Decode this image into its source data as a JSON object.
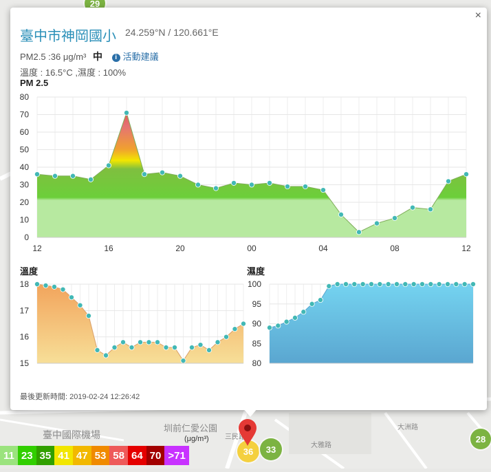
{
  "popup": {
    "title": "臺中市神岡國小",
    "coords": "24.259°N / 120.661°E",
    "pm_text": "PM2.5 :36 μg/m³",
    "pm_level": "中",
    "advice_link": "活動建議",
    "env_text": "溫度 : 16.5°C ,濕度 : 100%",
    "pm_chart_title": "PM 2.5",
    "temp_chart_title": "溫度",
    "humidity_chart_title": "濕度",
    "updated": "最後更新時間: 2019-02-24 12:26:42",
    "close": "×"
  },
  "map": {
    "labels": [
      "臺中國際機場",
      "圳前仁愛公園",
      "三民路",
      "大雅路",
      "大洲路"
    ],
    "unit": "(μg/m³)",
    "markers": [
      {
        "value": "29",
        "color": "#7cb342"
      },
      {
        "value": "36",
        "color": "#f4d03f"
      },
      {
        "value": "33",
        "color": "#7cb342"
      },
      {
        "value": "28",
        "color": "#7cb342"
      }
    ]
  },
  "legend": [
    {
      "label": "11",
      "color": "#9be37e"
    },
    {
      "label": "23",
      "color": "#31cf00"
    },
    {
      "label": "35",
      "color": "#31a000"
    },
    {
      "label": "41",
      "color": "#f2e600"
    },
    {
      "label": "47",
      "color": "#f2b800"
    },
    {
      "label": "53",
      "color": "#f08a00"
    },
    {
      "label": "58",
      "color": "#ee5a5a"
    },
    {
      "label": "64",
      "color": "#e50000"
    },
    {
      "label": "70",
      "color": "#a20000"
    },
    {
      "label": ">71",
      "color": "#c832ff"
    }
  ],
  "chart_data": [
    {
      "type": "area",
      "title": "PM 2.5",
      "x_ticks": [
        "12",
        "16",
        "20",
        "00",
        "04",
        "08",
        "12"
      ],
      "ylim": [
        0,
        80
      ],
      "y_ticks": [
        0,
        10,
        20,
        30,
        40,
        50,
        60,
        70,
        80
      ],
      "values": [
        36,
        35,
        35,
        33,
        41,
        71,
        36,
        37,
        35,
        30,
        28,
        31,
        30,
        31,
        29,
        29,
        27,
        13,
        3,
        8,
        11,
        17,
        16,
        32,
        36
      ],
      "grid": true
    },
    {
      "type": "area",
      "title": "溫度",
      "ylim": [
        15,
        18
      ],
      "y_ticks": [
        15,
        16,
        17,
        18
      ],
      "values": [
        18,
        17.95,
        17.9,
        17.8,
        17.5,
        17.2,
        16.8,
        15.5,
        15.3,
        15.6,
        15.8,
        15.6,
        15.8,
        15.8,
        15.8,
        15.6,
        15.6,
        15.1,
        15.6,
        15.7,
        15.5,
        15.8,
        16.0,
        16.3,
        16.5
      ],
      "grid": true
    },
    {
      "type": "area",
      "title": "濕度",
      "ylim": [
        80,
        100
      ],
      "y_ticks": [
        80,
        85,
        90,
        95,
        100
      ],
      "values": [
        89,
        89.5,
        90.5,
        91.5,
        93,
        95,
        96,
        99.5,
        100,
        100,
        100,
        100,
        100,
        100,
        100,
        100,
        100,
        100,
        100,
        100,
        100,
        100,
        100,
        100,
        100
      ],
      "grid": true
    }
  ]
}
